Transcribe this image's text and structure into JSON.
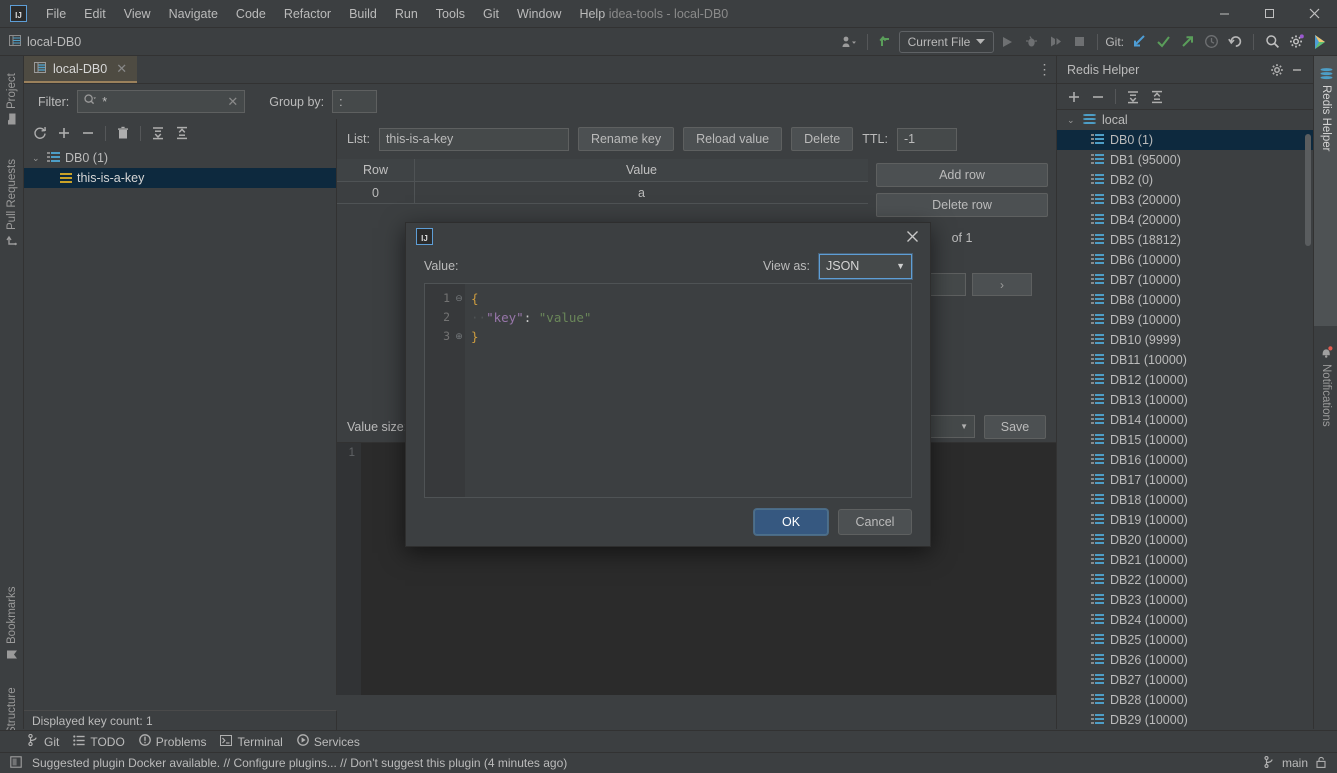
{
  "window": {
    "title": "idea-tools - local-DB0",
    "logo_text": "IJ",
    "minimize": "–",
    "maximize": "–",
    "close": "✕"
  },
  "menubar": {
    "items": [
      {
        "label": "File"
      },
      {
        "label": "Edit"
      },
      {
        "label": "View"
      },
      {
        "label": "Navigate"
      },
      {
        "label": "Code"
      },
      {
        "label": "Refactor"
      },
      {
        "label": "Build"
      },
      {
        "label": "Run"
      },
      {
        "label": "Tools"
      },
      {
        "label": "Git"
      },
      {
        "label": "Window"
      },
      {
        "label": "Help"
      }
    ]
  },
  "navbar": {
    "breadcrumb": "local-DB0",
    "run_config": "Current File",
    "git_label": "Git:",
    "icons": {
      "profile": "☷",
      "update": "↖",
      "run": "▶",
      "debug": "🐞",
      "coverage": "▷",
      "stop": "■",
      "git_pull": "↙",
      "git_commit": "✓",
      "git_push": "↗",
      "history": "◷",
      "rollback": "↺",
      "search": "⚲",
      "settings": "⚙",
      "ai": "▶"
    }
  },
  "left_strip": {
    "tabs": [
      {
        "label": "Project",
        "icon": "folder-icon",
        "glyph": "■"
      },
      {
        "label": "Pull Requests",
        "icon": "pull-request-icon",
        "glyph": "↱"
      },
      {
        "label": "Bookmarks",
        "icon": "bookmark-icon",
        "glyph": "⚑"
      },
      {
        "label": "Structure",
        "icon": "structure-icon",
        "glyph": "☷"
      }
    ]
  },
  "right_strip": {
    "tabs": [
      {
        "label": "Redis Helper",
        "icon": "redis-cylinder-icon",
        "selected": true
      },
      {
        "label": "Notifications",
        "icon": "bell-icon",
        "selected": false
      }
    ]
  },
  "editor": {
    "tab": {
      "label": "local-DB0",
      "icon": "db-table-icon",
      "close": "✕"
    },
    "more": "⋮",
    "filter": {
      "label": "Filter:",
      "value": "*",
      "search_icon": "search-icon",
      "clear_icon": "✕"
    },
    "group_by": {
      "label": "Group by:",
      "value": ":"
    },
    "tree_toolbar": {
      "refresh": "⟳",
      "add": "＋",
      "remove": "－",
      "delete": "🗑",
      "expand_all": "⤓",
      "collapse_all": "⤒"
    },
    "key_tree": {
      "root": {
        "label": "DB0 (1)",
        "icon": "db-icon",
        "chevron": "⌄"
      },
      "children": [
        {
          "label": "this-is-a-key",
          "icon": "key-list-icon",
          "selected": true
        }
      ]
    },
    "key_count": "Displayed key count: 1"
  },
  "value_panel": {
    "type_label": "List:",
    "key_name": "this-is-a-key",
    "buttons": {
      "rename": "Rename key",
      "reload": "Reload value",
      "delete": "Delete",
      "add_row": "Add row",
      "delete_row": "Delete row",
      "save": "Save"
    },
    "ttl_label": "TTL:",
    "ttl_value": "-1",
    "grid": {
      "columns": [
        "Row",
        "Value"
      ],
      "rows": [
        {
          "row": "0",
          "value": "a"
        }
      ]
    },
    "pager": {
      "of_text": "of 1",
      "page_value": "",
      "next": "›"
    },
    "value_size_label": "Value size:",
    "editor_line_number": "1"
  },
  "redis_panel": {
    "title": "Redis Helper",
    "gear_icon": "⚙",
    "minimize_icon": "–",
    "toolbar": {
      "add": "＋",
      "remove": "－",
      "expand_all": "⤓",
      "collapse_all": "⤒"
    },
    "root": {
      "label": "local",
      "chevron": "⌄",
      "icon": "server-cylinder-icon"
    },
    "databases": [
      {
        "label": "DB0 (1)",
        "selected": true
      },
      {
        "label": "DB1 (95000)",
        "selected": false
      },
      {
        "label": "DB2 (0)",
        "selected": false
      },
      {
        "label": "DB3 (20000)",
        "selected": false
      },
      {
        "label": "DB4 (20000)",
        "selected": false
      },
      {
        "label": "DB5 (18812)",
        "selected": false
      },
      {
        "label": "DB6 (10000)",
        "selected": false
      },
      {
        "label": "DB7 (10000)",
        "selected": false
      },
      {
        "label": "DB8 (10000)",
        "selected": false
      },
      {
        "label": "DB9 (10000)",
        "selected": false
      },
      {
        "label": "DB10 (9999)",
        "selected": false
      },
      {
        "label": "DB11 (10000)",
        "selected": false
      },
      {
        "label": "DB12 (10000)",
        "selected": false
      },
      {
        "label": "DB13 (10000)",
        "selected": false
      },
      {
        "label": "DB14 (10000)",
        "selected": false
      },
      {
        "label": "DB15 (10000)",
        "selected": false
      },
      {
        "label": "DB16 (10000)",
        "selected": false
      },
      {
        "label": "DB17 (10000)",
        "selected": false
      },
      {
        "label": "DB18 (10000)",
        "selected": false
      },
      {
        "label": "DB19 (10000)",
        "selected": false
      },
      {
        "label": "DB20 (10000)",
        "selected": false
      },
      {
        "label": "DB21 (10000)",
        "selected": false
      },
      {
        "label": "DB22 (10000)",
        "selected": false
      },
      {
        "label": "DB23 (10000)",
        "selected": false
      },
      {
        "label": "DB24 (10000)",
        "selected": false
      },
      {
        "label": "DB25 (10000)",
        "selected": false
      },
      {
        "label": "DB26 (10000)",
        "selected": false
      },
      {
        "label": "DB27 (10000)",
        "selected": false
      },
      {
        "label": "DB28 (10000)",
        "selected": false
      },
      {
        "label": "DB29 (10000)",
        "selected": false
      }
    ]
  },
  "dialog": {
    "logo_text": "IJ",
    "close_icon": "✕",
    "value_label": "Value:",
    "view_as_label": "View as:",
    "view_as_value": "JSON",
    "view_as_arrow": "▼",
    "code": {
      "lines": [
        {
          "num": "1",
          "fold": "⊖",
          "tokens": [
            {
              "t": "{",
              "c": "c-brace"
            }
          ]
        },
        {
          "num": "2",
          "fold": "",
          "tokens": [
            {
              "t": "··",
              "c": "c-dot"
            },
            {
              "t": "\"key\"",
              "c": "c-key"
            },
            {
              "t": ":",
              "c": "c-colon"
            },
            {
              "t": " ",
              "c": "c-colon"
            },
            {
              "t": "\"value\"",
              "c": "c-str"
            }
          ]
        },
        {
          "num": "3",
          "fold": "⊕",
          "tokens": [
            {
              "t": "}",
              "c": "c-brace"
            }
          ]
        }
      ]
    },
    "ok_label": "OK",
    "cancel_label": "Cancel"
  },
  "toolwindow_bar": {
    "items": [
      {
        "label": "Git",
        "icon": "git-branch-icon",
        "glyph": "⑂"
      },
      {
        "label": "TODO",
        "icon": "todo-list-icon",
        "glyph": "☰"
      },
      {
        "label": "Problems",
        "icon": "problems-icon",
        "glyph": "❗"
      },
      {
        "label": "Terminal",
        "icon": "terminal-icon",
        "glyph": "⬛"
      },
      {
        "label": "Services",
        "icon": "services-icon",
        "glyph": "▶"
      }
    ]
  },
  "statusbar": {
    "icon": "notification-log-icon",
    "message": "Suggested plugin Docker available. // Configure plugins... // Don't suggest this plugin (4 minutes ago)",
    "branch": "main",
    "branch_icon": "⑂",
    "lock_icon": "🔓"
  },
  "colors": {
    "accent_blue": "#5e9ed6",
    "selection": "#0d293e",
    "panel_bg": "#3c3f41",
    "editor_bg": "#2b2b2b",
    "tab_active": "#4e4b42",
    "tab_underline": "#9b815c",
    "primary_button": "#365880",
    "json_brace": "#cc9c3f",
    "json_key": "#9876aa",
    "json_string": "#6a8759",
    "db_icon_blue": "#4d9ec7",
    "key_icon_gold": "#c9a227"
  }
}
